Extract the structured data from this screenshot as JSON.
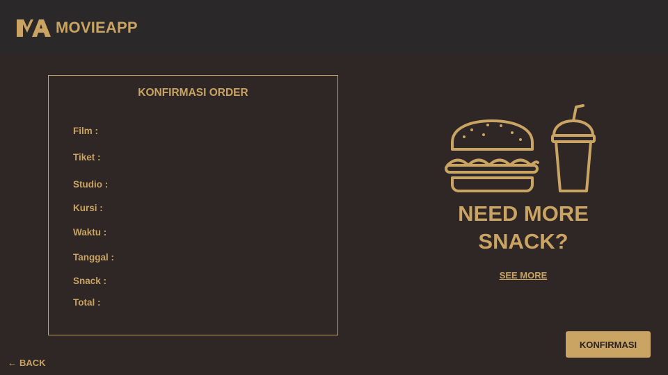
{
  "header": {
    "logo_mark": "MA",
    "app_name": "MOVIEAPP"
  },
  "order": {
    "title": "KONFIRMASI ORDER",
    "fields": [
      {
        "label": "Film :"
      },
      {
        "label": "Tiket :"
      },
      {
        "label": "Studio :"
      },
      {
        "label": "Kursi :"
      },
      {
        "label": "Waktu :"
      },
      {
        "label": "Tanggal :"
      },
      {
        "label": "Snack :"
      },
      {
        "label": "Total :"
      }
    ]
  },
  "promo": {
    "line1": "NEED MORE",
    "line2": "SNACK?",
    "see_more": "SEE MORE",
    "icons": [
      "burger-icon",
      "drink-cup-icon"
    ]
  },
  "actions": {
    "confirm_label": "KONFIRMASI",
    "back_label": "BACK",
    "back_icon": "arrow-left-icon"
  },
  "colors": {
    "accent": "#c9a462",
    "background": "#2f2626",
    "topbar": "#2a2828"
  }
}
